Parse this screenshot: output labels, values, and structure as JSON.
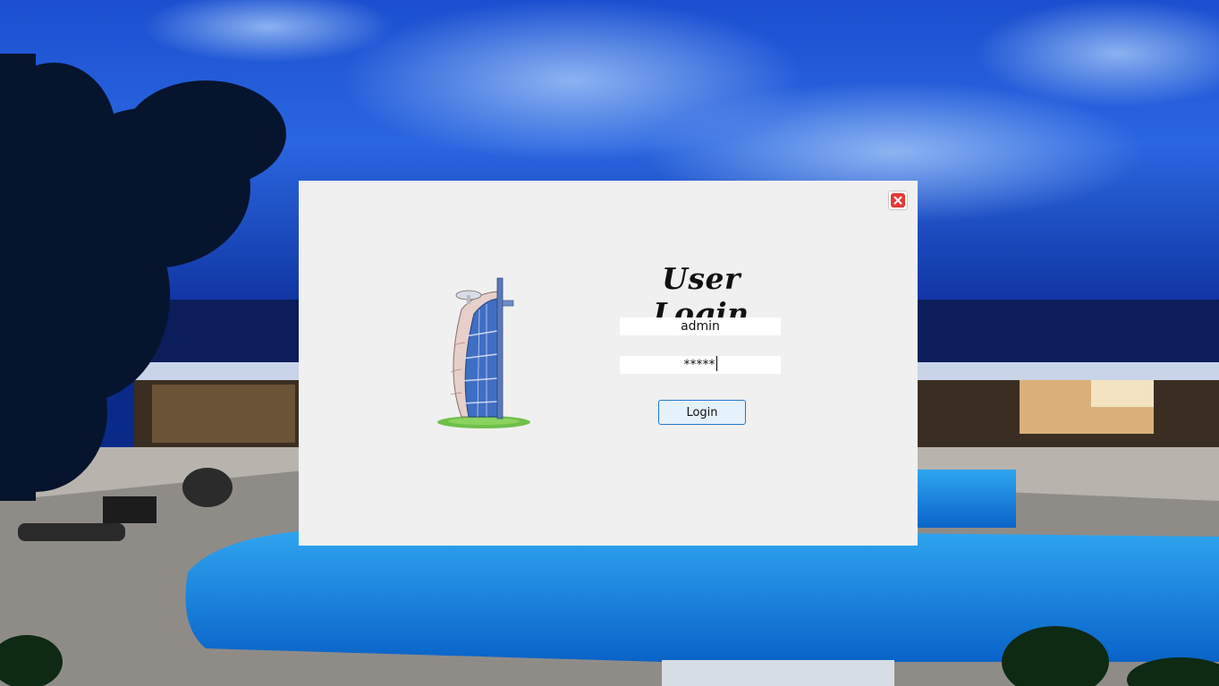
{
  "background": {
    "description_icon": "hotel-pool-night-scene"
  },
  "dialog": {
    "title": "User Login",
    "username_value": "admin",
    "password_masked": "*****",
    "login_label": "Login",
    "close_icon": "close-icon",
    "logo_icon": "hotel-tower-icon"
  },
  "colors": {
    "dialog_bg": "#f0f0f0",
    "button_border": "#1d78cc",
    "button_bg": "#e5f1fb",
    "close_red": "#e53935"
  }
}
